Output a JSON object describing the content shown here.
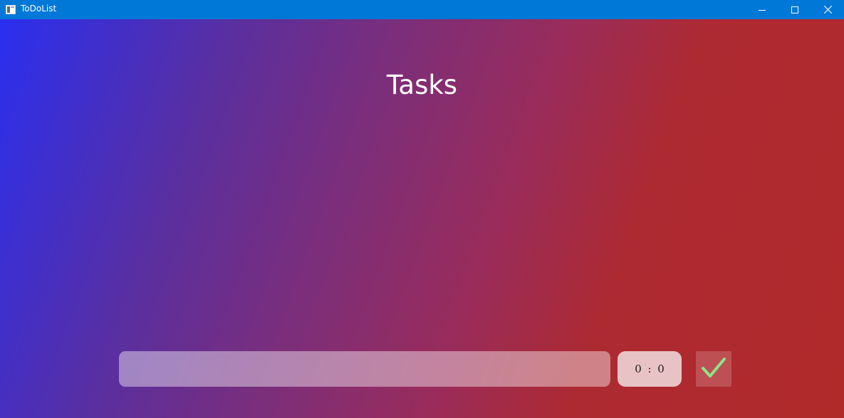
{
  "window": {
    "title": "ToDoList",
    "icons": {
      "app": "app-window-icon",
      "minimize": "minimize-icon",
      "maximize": "maximize-icon",
      "close": "close-icon"
    },
    "titlebar_color": "#0078d7"
  },
  "main": {
    "title": "Tasks",
    "task_input": {
      "value": "",
      "placeholder": ""
    },
    "time": {
      "hours": "0",
      "separator": ":",
      "minutes": "0"
    },
    "confirm_icon": "checkmark-icon",
    "confirm_color": "#8fe38a"
  },
  "colors": {
    "gradient_start": "#2a2ff0",
    "gradient_end": "#b02a2a"
  }
}
